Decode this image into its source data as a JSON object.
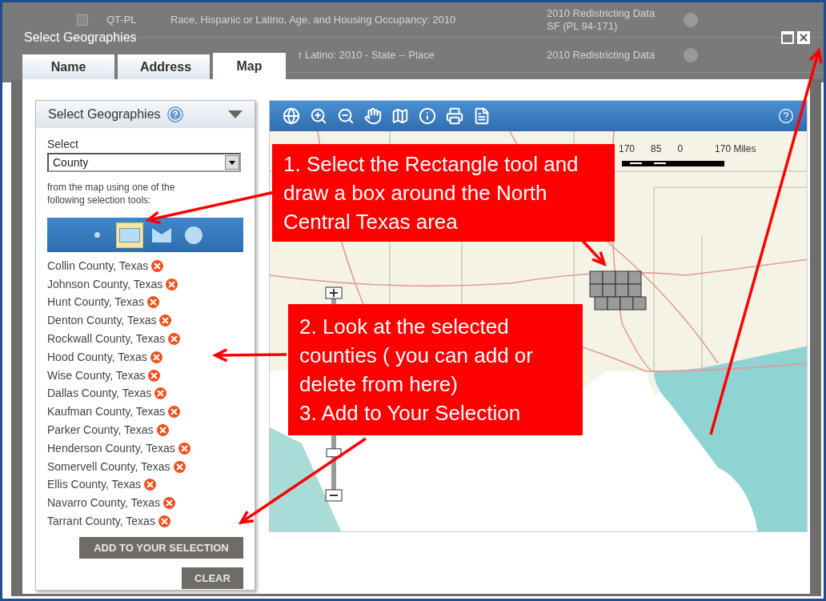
{
  "background_table": {
    "rows": [
      {
        "checked": false,
        "code": "QT-PL",
        "title": "Race, Hispanic or Latino, Age, and Housing Occupancy: 2010",
        "dataset": "2010 Redistricting Data SF (PL 94-171)"
      },
      {
        "code": "",
        "title": "r Latino: 2010 - State -- Place",
        "dataset": "2010 Redistricting Data"
      }
    ]
  },
  "dialog": {
    "title": "Select Geographies",
    "tabs": [
      {
        "label": "Name",
        "selected": false
      },
      {
        "label": "Address",
        "selected": false
      },
      {
        "label": "Map",
        "selected": true
      }
    ],
    "panel": {
      "title": "Select Geographies",
      "select_label": "Select",
      "select_value": "County",
      "instructions": "from the map using one of the following selection tools:",
      "selection_tools": [
        {
          "kind": "point",
          "selected": false
        },
        {
          "kind": "rectangle",
          "selected": true
        },
        {
          "kind": "polygon",
          "selected": false
        },
        {
          "kind": "circle",
          "selected": false
        }
      ],
      "counties": [
        "Collin County, Texas",
        "Johnson County, Texas",
        "Hunt County, Texas",
        "Denton County, Texas",
        "Rockwall County, Texas",
        "Hood County, Texas",
        "Wise County, Texas",
        "Dallas County, Texas",
        "Kaufman County, Texas",
        "Parker County, Texas",
        "Henderson County, Texas",
        "Somervell County, Texas",
        "Ellis County, Texas",
        "Navarro County, Texas",
        "Tarrant County, Texas"
      ],
      "buttons": [
        "ADD TO YOUR SELECTION",
        "CLEAR"
      ]
    },
    "map": {
      "zoom": {
        "level": 0.19
      },
      "scale_labels": [
        "170",
        "85",
        "0",
        "170 Miles"
      ]
    }
  },
  "annotations": [
    "1. Select the Rectangle tool and draw a box around the North Central Texas area",
    "2. Look at the selected counties ( you can add or delete from here)\n3. Add to Your Selection"
  ]
}
